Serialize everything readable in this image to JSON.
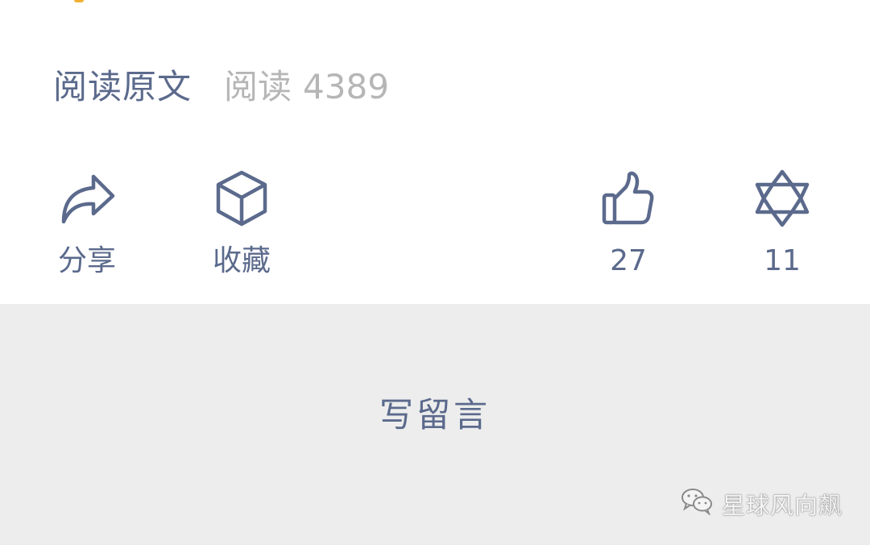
{
  "read_row": {
    "read_original_label": "阅读原文",
    "read_label": "阅读",
    "read_count": "4389"
  },
  "actions": {
    "share": {
      "label": "分享",
      "icon": "share-icon"
    },
    "collect": {
      "label": "收藏",
      "icon": "box-icon"
    },
    "like": {
      "label": "27",
      "icon": "thumbs-up-icon"
    },
    "wow": {
      "label": "11",
      "icon": "star-of-david-icon"
    }
  },
  "comment": {
    "write_label": "写留言"
  },
  "watermark": {
    "text": "星球风向飙",
    "icon": "wechat-icon"
  },
  "colors": {
    "accent": "#5b6a8c",
    "muted": "#b6b6b6",
    "comment_bg": "#ededed",
    "top_accent": "#f0b030"
  }
}
